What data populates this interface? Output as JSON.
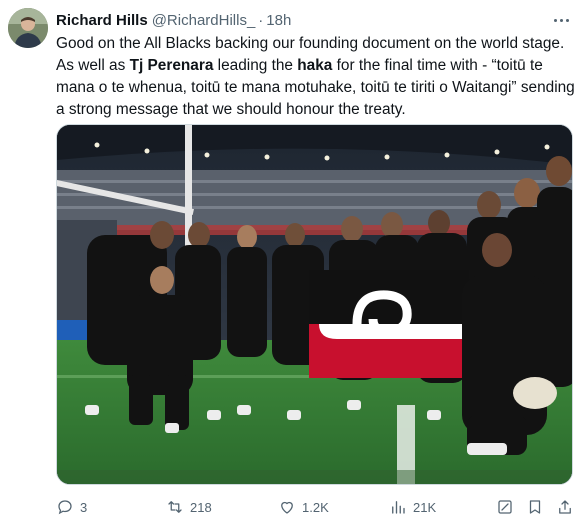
{
  "tweet": {
    "author_name": "Richard Hills",
    "author_handle": "@RichardHills_",
    "separator": "·",
    "time": "18h",
    "text_parts": [
      {
        "t": "Good on the All Blacks backing our founding document on the world stage. As well as ",
        "b": false
      },
      {
        "t": "Tj Perenara",
        "b": true
      },
      {
        "t": " leading the ",
        "b": false
      },
      {
        "t": "haka",
        "b": true
      },
      {
        "t": " for the final time with - “toitū te mana o te whenua, toitū te mana motuhake, toitū te tiriti o Waitangi” sending a strong message that we should honour the treaty.",
        "b": false
      }
    ]
  },
  "icons": {
    "more": "more-dots-icon",
    "reply": "reply-icon",
    "retweet": "retweet-icon",
    "like": "heart-icon",
    "views": "views-chart-icon",
    "bookmark": "bookmark-icon",
    "share": "share-icon",
    "grok": "grok-icon"
  },
  "actions": {
    "replies": "3",
    "reposts": "218",
    "likes": "1.2K",
    "views": "21K"
  },
  "colors": {
    "text": "#0f1419",
    "secondary": "#536471",
    "border": "#cfd9de",
    "flag_red": "#c8102e",
    "flag_black": "#111111"
  }
}
